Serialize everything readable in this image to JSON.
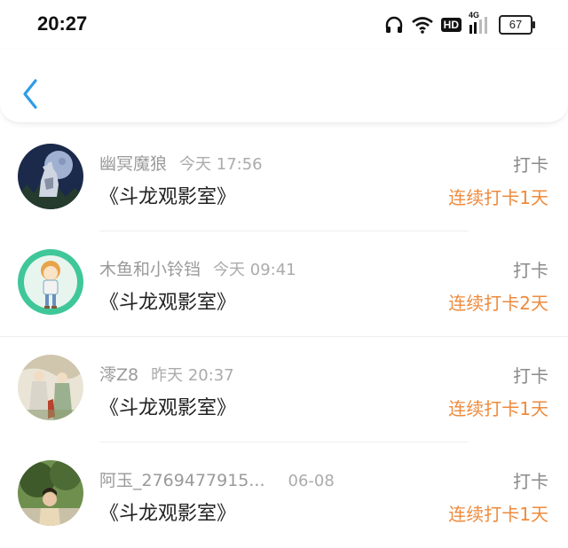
{
  "status_bar": {
    "time": "20:27",
    "hd": "HD",
    "network": "4G",
    "battery": "67",
    "icons": [
      "headphones-icon",
      "wifi-icon",
      "hd-icon",
      "signal-icon",
      "battery-icon"
    ]
  },
  "header": {
    "back_icon": "chevron-left-icon",
    "accent": "#2f9be8"
  },
  "colors": {
    "streak": "#ee8a3c",
    "muted": "#9a9a9a"
  },
  "checkins": [
    {
      "user": "幽冥魔狼",
      "time": "今天 17:56",
      "title": "《斗龙观影室》",
      "action": "打卡",
      "streak": "连续打卡1天"
    },
    {
      "user": "木鱼和小铃铛",
      "time": "今天 09:41",
      "title": "《斗龙观影室》",
      "action": "打卡",
      "streak": "连续打卡2天"
    },
    {
      "user": "澪Z8",
      "time": "昨天 20:37",
      "title": "《斗龙观影室》",
      "action": "打卡",
      "streak": "连续打卡1天"
    },
    {
      "user": "阿玉_2769477915...",
      "time": "06-08",
      "title": "《斗龙观影室》",
      "action": "打卡",
      "streak": "连续打卡1天"
    }
  ]
}
